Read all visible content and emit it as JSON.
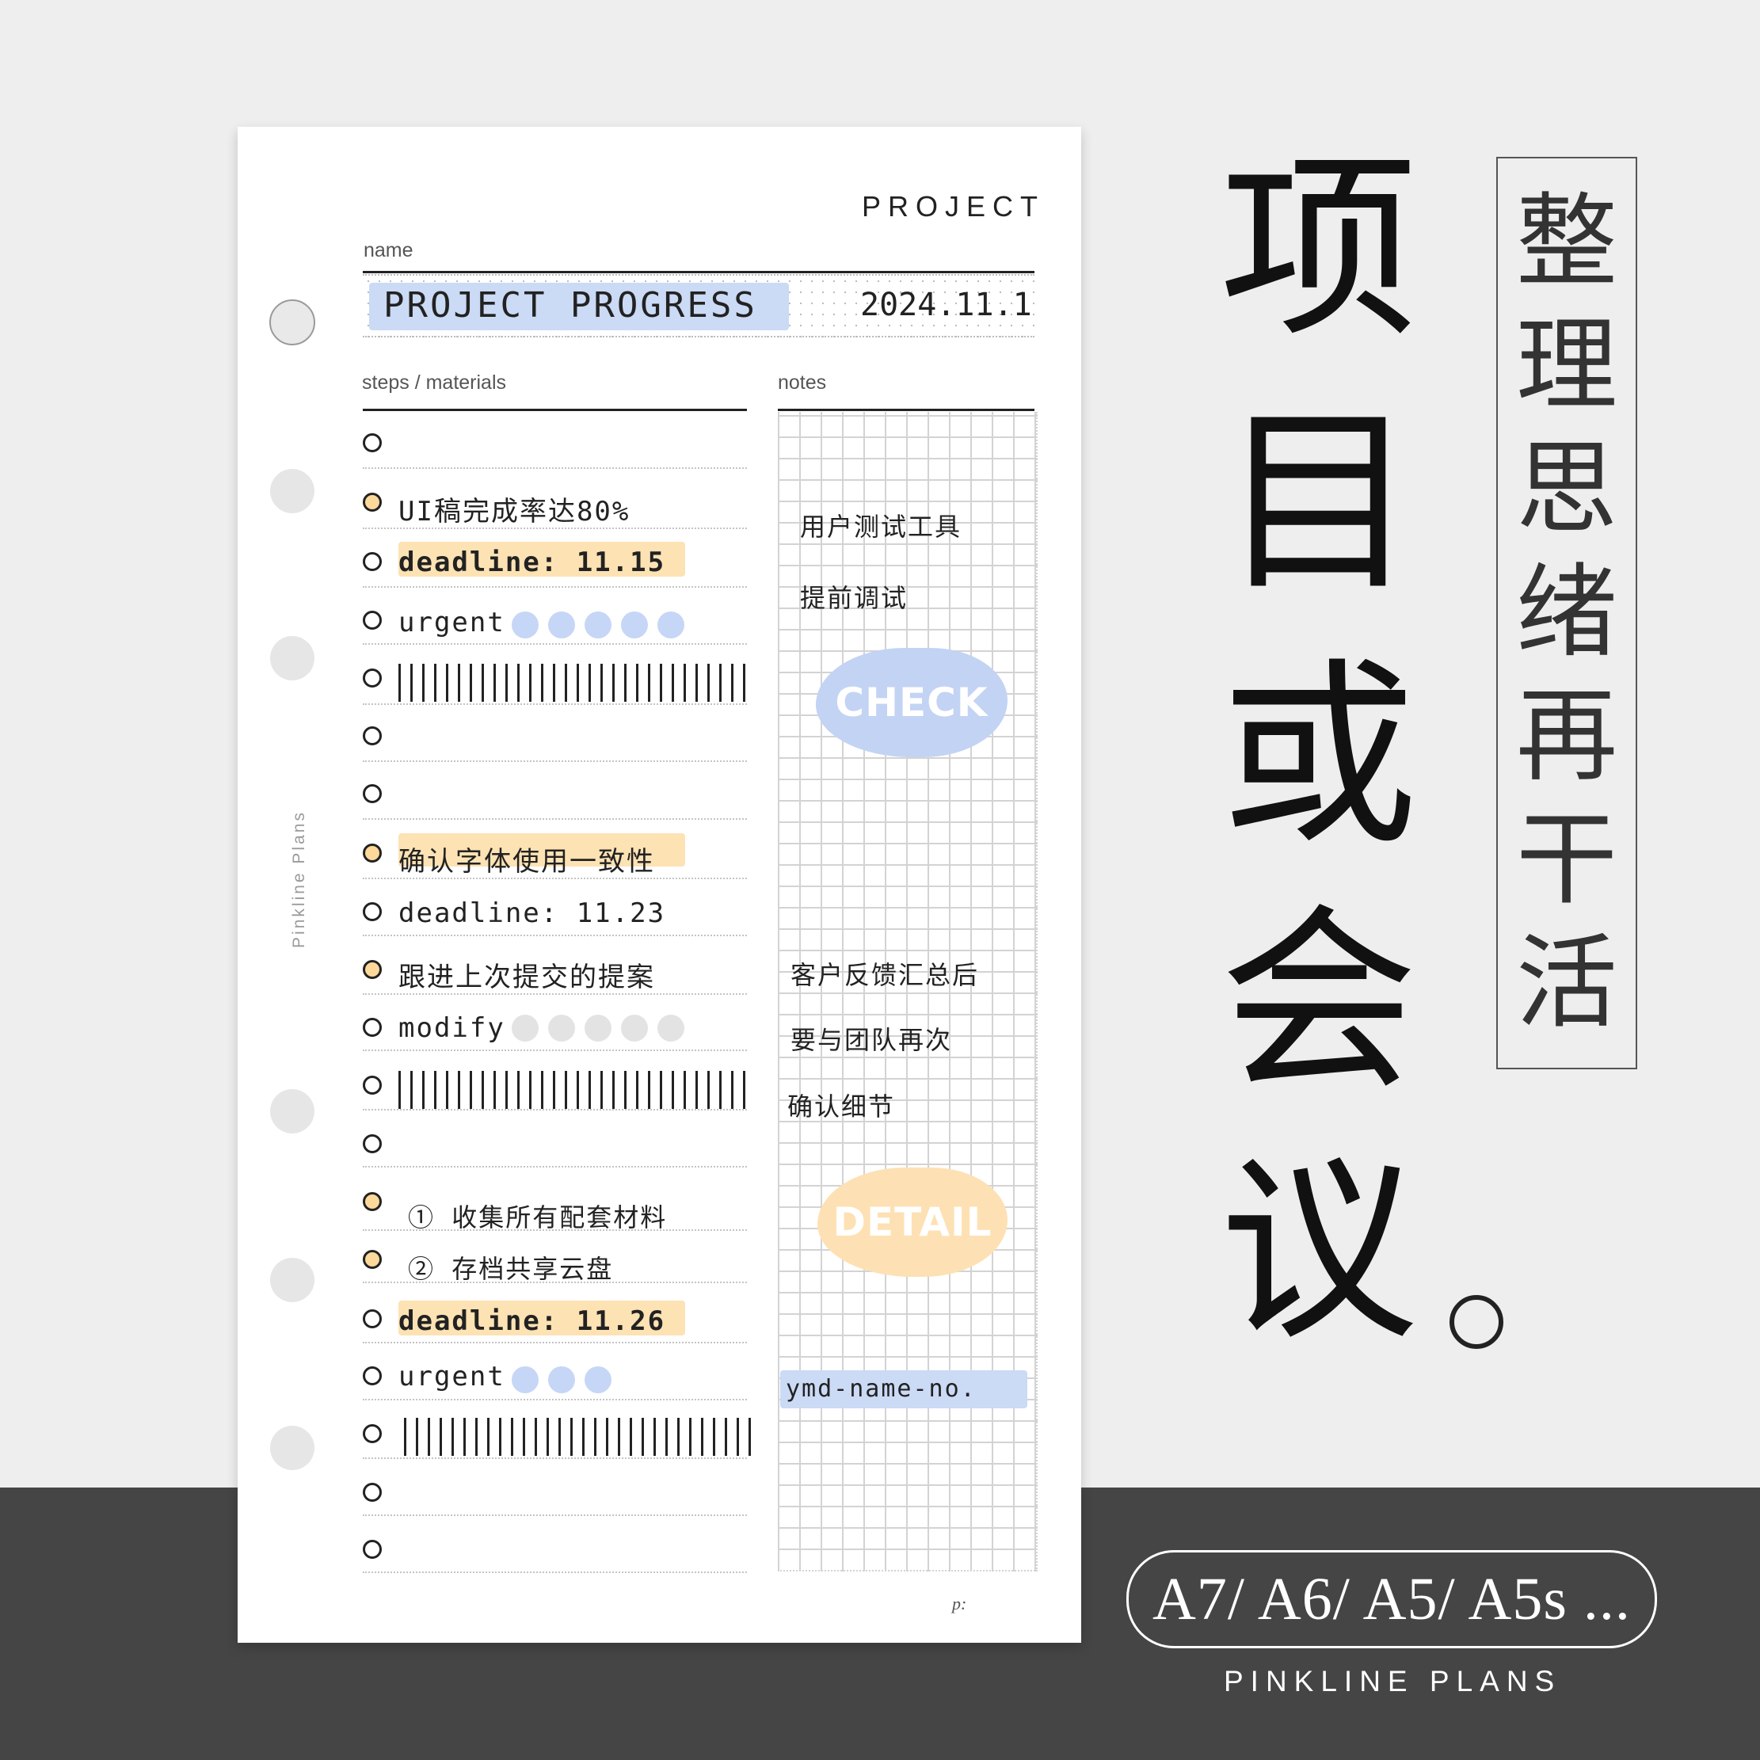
{
  "sheet": {
    "header": "PROJECT",
    "name_label": "name",
    "project_name": "PROJECT PROGRESS",
    "date": "2024.11.1",
    "steps_label": "steps / materials",
    "notes_label": "notes",
    "brand_vertical": "Pinkline Plans",
    "page_label": "p:"
  },
  "steps": [
    {
      "text": ""
    },
    {
      "text": "UI稿完成率达80%"
    },
    {
      "text": "deadline: 11.15"
    },
    {
      "text": "urgent"
    },
    {
      "text": ""
    },
    {
      "text": ""
    },
    {
      "text": ""
    },
    {
      "text": "确认字体使用一致性"
    },
    {
      "text": "deadline: 11.23"
    },
    {
      "text": "跟进上次提交的提案"
    },
    {
      "text": "modify"
    },
    {
      "text": ""
    },
    {
      "text": ""
    },
    {
      "text": "① 收集所有配套材料"
    },
    {
      "text": "② 存档共享云盘"
    },
    {
      "text": "deadline: 11.26"
    },
    {
      "text": "urgent"
    },
    {
      "text": ""
    },
    {
      "text": ""
    },
    {
      "text": ""
    }
  ],
  "notes": {
    "line1": "用户测试工具",
    "line2": "提前调试",
    "sticker_check": "CHECK",
    "line3": "客户反馈汇总后",
    "line4": "要与团队再次",
    "line5": "确认细节",
    "sticker_detail": "DETAIL",
    "filename": "ymd-name-no."
  },
  "title": {
    "chars": [
      "项",
      "目",
      "或",
      "会",
      "议"
    ],
    "period": "。",
    "vertical_chars": [
      "整",
      "理",
      "思",
      "绪",
      "再",
      "干",
      "活"
    ]
  },
  "footer": {
    "sizes": "A7/ A6/ A5/ A5s ...",
    "brand": "PINKLINE PLANS"
  },
  "colors": {
    "background": "#eeeeee",
    "band": "#454545",
    "tape_blue": "#cbdaf5",
    "tape_yellow": "#fde2b4",
    "dot_blue": "#c6d6f6",
    "dot_grey": "#e3e3e3",
    "bullet_fill": "#fcd89a"
  }
}
